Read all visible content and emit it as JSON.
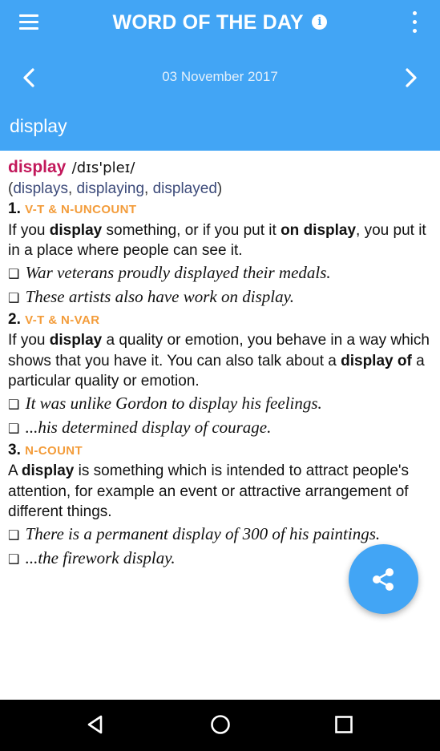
{
  "appbar": {
    "title": "WORD OF THE DAY",
    "info_glyph": "i",
    "date": "03 November 2017",
    "word": "display",
    "icons": [
      "menu-icon",
      "info-icon",
      "more-vert-icon",
      "chevron-left-icon",
      "chevron-right-icon"
    ]
  },
  "entry": {
    "headword": "display",
    "pronunciation": "/dɪs'pleɪ/",
    "forms_open": "(",
    "forms": [
      "displays",
      "displaying",
      "displayed"
    ],
    "forms_sep": ", ",
    "forms_close": ")",
    "bullet": "❑",
    "senses": [
      {
        "num": "1.",
        "grammar": "V-T & N-UNCOUNT",
        "def": {
          "p1": "If you ",
          "b1": "display",
          "p2": " something, or if you put it ",
          "b2": "on display",
          "p3": ", you put it in a place where people can see it."
        },
        "examples": [
          "War veterans proudly displayed their medals.",
          "These artists also have work on display."
        ]
      },
      {
        "num": "2.",
        "grammar": "V-T & N-VAR",
        "def": {
          "p1": "If you ",
          "b1": "display",
          "p2": " a quality or emotion, you behave in a way which shows that you have it. You can also talk about a ",
          "b2": "display of",
          "p3": " a particular quality or emotion."
        },
        "examples": [
          "It was unlike Gordon to display his feelings.",
          "...his determined display of courage."
        ]
      },
      {
        "num": "3.",
        "grammar": "N-COUNT",
        "def": {
          "p1": "A ",
          "b1": "display",
          "p2": " is something which is intended to attract people's attention, for example an event or attractive arrangement of different things."
        },
        "examples": [
          "There is a permanent display of 300 of his paintings.",
          "...the firework display."
        ]
      }
    ]
  },
  "fab": {
    "icon": "share-icon"
  },
  "navbar": {
    "icons": [
      "back-icon",
      "home-icon",
      "recents-icon"
    ]
  },
  "colors": {
    "primary": "#42a5f5",
    "headword": "#c2185b",
    "grammar": "#f39c3a",
    "navbar": "#000000"
  }
}
